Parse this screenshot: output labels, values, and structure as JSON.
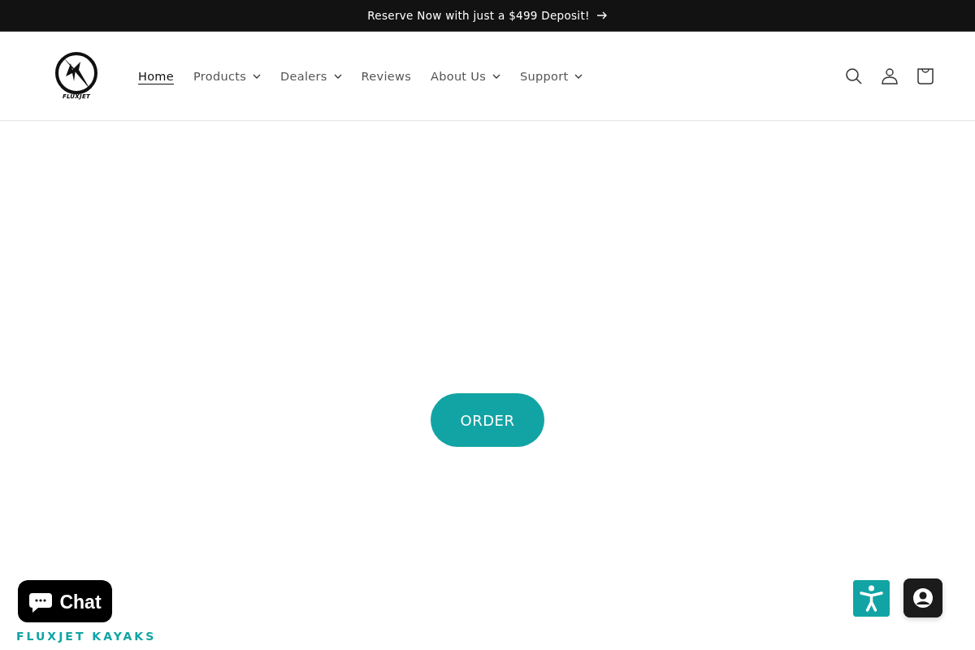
{
  "announcement": {
    "text": "Reserve Now with just a $499 Deposit!",
    "arrow": true
  },
  "header": {
    "logo_text": "FLUXJET",
    "nav": [
      {
        "label": "Home",
        "selected": true,
        "dropdown": false
      },
      {
        "label": "Products",
        "selected": false,
        "dropdown": true
      },
      {
        "label": "Dealers",
        "selected": false,
        "dropdown": true
      },
      {
        "label": "Reviews",
        "selected": false,
        "dropdown": false
      },
      {
        "label": "About Us",
        "selected": false,
        "dropdown": true
      },
      {
        "label": "Support",
        "selected": false,
        "dropdown": true
      }
    ]
  },
  "hero": {
    "button": "ORDER"
  },
  "footer_heading": "FLUXJET KAYAKS",
  "chat": {
    "label": "Chat"
  }
}
